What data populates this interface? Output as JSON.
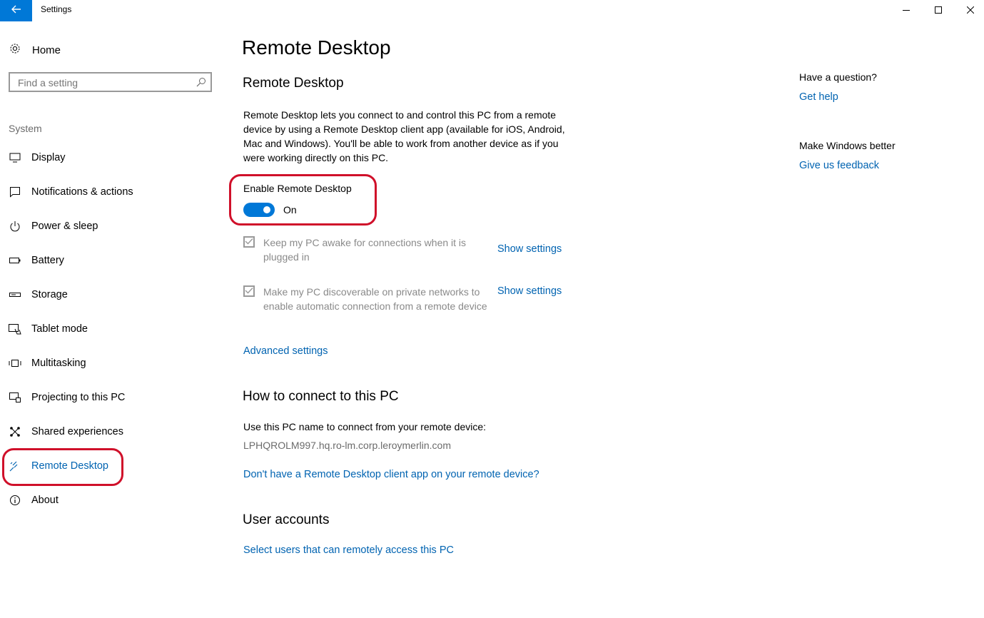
{
  "window": {
    "title": "Settings"
  },
  "sidebar": {
    "home_label": "Home",
    "search_placeholder": "Find a setting",
    "section_label": "System",
    "items": [
      {
        "label": "Display",
        "icon": "monitor-icon"
      },
      {
        "label": "Notifications & actions",
        "icon": "notification-icon"
      },
      {
        "label": "Power & sleep",
        "icon": "power-icon"
      },
      {
        "label": "Battery",
        "icon": "battery-icon"
      },
      {
        "label": "Storage",
        "icon": "storage-icon"
      },
      {
        "label": "Tablet mode",
        "icon": "tablet-mode-icon"
      },
      {
        "label": "Multitasking",
        "icon": "multitasking-icon"
      },
      {
        "label": "Projecting to this PC",
        "icon": "projecting-icon"
      },
      {
        "label": "Shared experiences",
        "icon": "shared-experiences-icon"
      },
      {
        "label": "Remote Desktop",
        "icon": "remote-desktop-icon",
        "active": true
      },
      {
        "label": "About",
        "icon": "info-icon"
      }
    ]
  },
  "main": {
    "page_title": "Remote Desktop",
    "section_title": "Remote Desktop",
    "description": "Remote Desktop lets you connect to and control this PC from a remote device by using a Remote Desktop client app (available for iOS, Android, Mac and Windows). You'll be able to work from another device as if you were working directly on this PC.",
    "enable_label": "Enable Remote Desktop",
    "toggle_state": "On",
    "options": [
      {
        "label": "Keep my PC awake for connections when it is plugged in",
        "checked": true,
        "link": "Show settings"
      },
      {
        "label": "Make my PC discoverable on private networks to enable automatic connection from a remote device",
        "checked": true,
        "link": "Show settings"
      }
    ],
    "advanced_link": "Advanced settings",
    "connect_title": "How to connect to this PC",
    "connect_text": "Use this PC name to connect from your remote device:",
    "pc_name": "LPHQROLM997.hq.ro-lm.corp.leroymerlin.com",
    "client_link": "Don't have a Remote Desktop client app on your remote device?",
    "accounts_title": "User accounts",
    "accounts_link": "Select users that can remotely access this PC"
  },
  "aside": {
    "question_title": "Have a question?",
    "help_link": "Get help",
    "better_title": "Make Windows better",
    "feedback_link": "Give us feedback"
  },
  "colors": {
    "accent": "#0078d7",
    "link": "#0063b1",
    "highlight": "#d0102a"
  }
}
